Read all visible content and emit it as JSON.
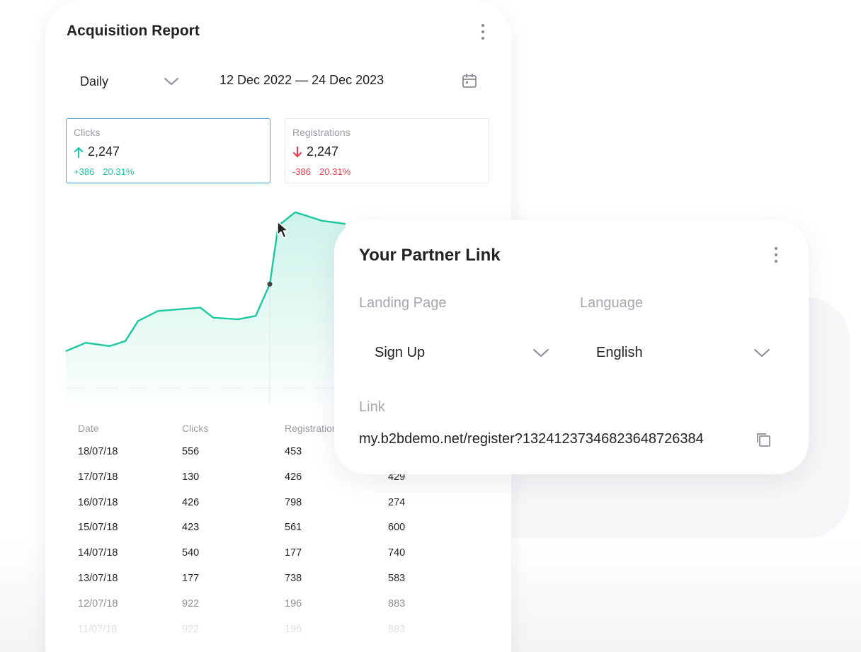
{
  "report": {
    "title": "Acquisition Report",
    "period": "Daily",
    "date_range": "12 Dec 2022 — 24 Dec 2023",
    "metrics": [
      {
        "label": "Clicks",
        "value": "2,247",
        "trend": "up",
        "delta": "+386",
        "percent": "20.31%",
        "color": "#1dc8a0"
      },
      {
        "label": "Registrations",
        "value": "2,247",
        "trend": "down",
        "delta": "-386",
        "percent": "20.31%",
        "color": "#e8414e"
      }
    ],
    "table": {
      "headers": [
        "Date",
        "Clicks",
        "Registrations",
        ""
      ],
      "rows": [
        [
          "18/07/18",
          "556",
          "453",
          ""
        ],
        [
          "17/07/18",
          "130",
          "426",
          "429"
        ],
        [
          "16/07/18",
          "426",
          "798",
          "274"
        ],
        [
          "15/07/18",
          "423",
          "561",
          "600"
        ],
        [
          "14/07/18",
          "540",
          "177",
          "740"
        ],
        [
          "13/07/18",
          "177",
          "738",
          "583"
        ],
        [
          "12/07/18",
          "922",
          "196",
          "883"
        ],
        [
          "11/07/18",
          "922",
          "196",
          "883"
        ]
      ]
    }
  },
  "partner": {
    "title": "Your Partner Link",
    "landing_label": "Landing Page",
    "landing_value": "Sign Up",
    "language_label": "Language",
    "language_value": "English",
    "link_label": "Link",
    "link_value": "my.b2bdemo.net/register?13241237346823648726384"
  },
  "icons": {
    "menu": "kebab-menu-icon",
    "dropdown": "chevron-down-icon",
    "calendar": "calendar-icon",
    "trend_up": "arrow-up-icon",
    "trend_down": "arrow-down-icon",
    "copy": "copy-icon",
    "cursor": "mouse-pointer-icon"
  },
  "colors": {
    "accent": "#1dc8a0",
    "negative": "#e8414e",
    "selected_border": "#4a9fe0"
  },
  "chart_data": {
    "type": "area",
    "series_color": "#1dc8a0",
    "values": [
      22,
      27,
      25,
      28,
      40,
      46,
      47,
      48,
      42,
      41,
      43,
      62,
      97,
      105,
      100,
      98
    ]
  }
}
